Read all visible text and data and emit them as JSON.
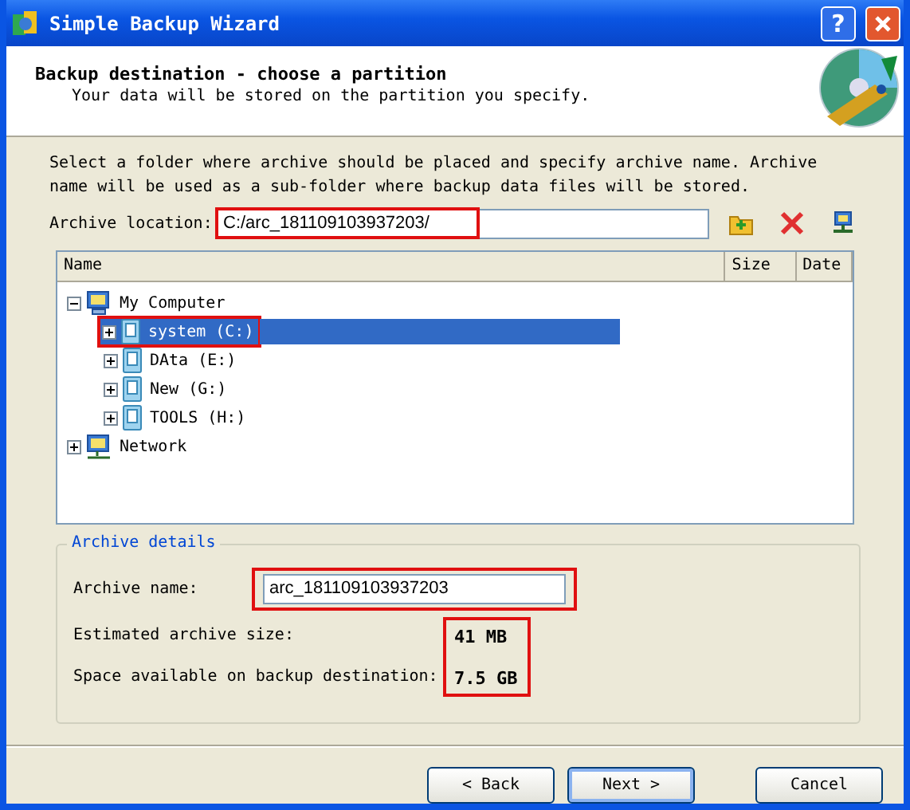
{
  "window": {
    "title": "Simple Backup Wizard",
    "help_label": "?"
  },
  "header": {
    "title": "Backup destination - choose a partition",
    "subtitle": "Your data will be stored on the partition you specify."
  },
  "instructions": "Select a folder where archive should be placed and specify archive name. Archive name will be used as a sub-folder where backup data files will be stored.",
  "location": {
    "label": "Archive location:",
    "value": "C:/arc_181109103937203/",
    "highlighted": true
  },
  "tree": {
    "columns": [
      "Name",
      "Size",
      "Date"
    ],
    "nodes": [
      {
        "label": "My Computer",
        "kind": "computer",
        "expanded": true,
        "selected": false,
        "highlighted": false,
        "children": [
          {
            "label": "system (C:)",
            "kind": "drive",
            "expanded": false,
            "selected": true,
            "highlighted": true
          },
          {
            "label": "DAta (E:)",
            "kind": "drive",
            "expanded": false,
            "selected": false,
            "highlighted": false
          },
          {
            "label": "New (G:)",
            "kind": "drive",
            "expanded": false,
            "selected": false,
            "highlighted": false
          },
          {
            "label": "TOOLS (H:)",
            "kind": "drive",
            "expanded": false,
            "selected": false,
            "highlighted": false
          }
        ]
      },
      {
        "label": "Network",
        "kind": "network",
        "expanded": false,
        "selected": false,
        "highlighted": false
      }
    ]
  },
  "details": {
    "title": "Archive details",
    "name_label": "Archive name:",
    "name_value": "arc_181109103937203",
    "name_highlighted": true,
    "values_highlighted": true,
    "stats": [
      {
        "label": "Estimated archive size:",
        "value": "41 MB"
      },
      {
        "label": "Space available on backup destination:",
        "value": "7.5 GB"
      }
    ]
  },
  "buttons": [
    {
      "label": "< Back",
      "default": false
    },
    {
      "label": "Next >",
      "default": true
    },
    {
      "label": "Cancel",
      "default": false
    }
  ]
}
